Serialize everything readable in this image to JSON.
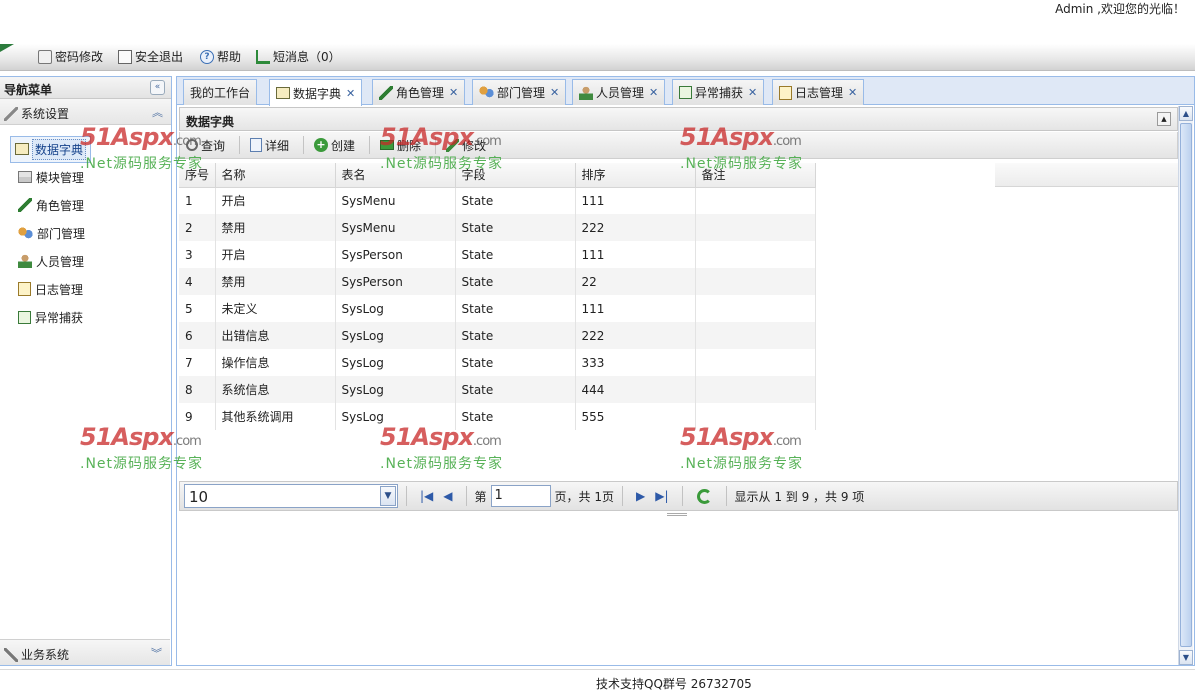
{
  "header": {
    "welcome": "Admin ,欢迎您的光临！"
  },
  "top_toolbar": [
    {
      "label": "密码修改",
      "icon": "key-icon"
    },
    {
      "label": "安全退出",
      "icon": "exit-icon"
    },
    {
      "label": "帮助",
      "icon": "help-icon"
    },
    {
      "label": "短消息（0）",
      "icon": "message-icon"
    }
  ],
  "nav": {
    "title": "导航菜单",
    "section": "系统设置",
    "items": [
      {
        "label": "数据字典",
        "icon": "dictionary-icon"
      },
      {
        "label": "模块管理",
        "icon": "module-icon"
      },
      {
        "label": "角色管理",
        "icon": "role-icon"
      },
      {
        "label": "部门管理",
        "icon": "department-icon"
      },
      {
        "label": "人员管理",
        "icon": "person-icon"
      },
      {
        "label": "日志管理",
        "icon": "log-icon"
      },
      {
        "label": "异常捕获",
        "icon": "exception-icon"
      }
    ],
    "bottom_section": "业务系统"
  },
  "tabs": [
    {
      "label": "我的工作台"
    },
    {
      "label": "数据字典"
    },
    {
      "label": "角色管理"
    },
    {
      "label": "部门管理"
    },
    {
      "label": "人员管理"
    },
    {
      "label": "异常捕获"
    },
    {
      "label": "日志管理"
    }
  ],
  "panel": {
    "title": "数据字典"
  },
  "grid_toolbar": [
    {
      "label": "查询",
      "icon": "search-icon"
    },
    {
      "label": "详细",
      "icon": "detail-icon"
    },
    {
      "label": "创建",
      "icon": "add-icon"
    },
    {
      "label": "删除",
      "icon": "delete-icon"
    },
    {
      "label": "修改",
      "icon": "edit-icon"
    }
  ],
  "table": {
    "columns": [
      "序号",
      "名称",
      "表名",
      "字段",
      "排序",
      "备注"
    ],
    "rows": [
      [
        "1",
        "开启",
        "SysMenu",
        "State",
        "111",
        ""
      ],
      [
        "2",
        "禁用",
        "SysMenu",
        "State",
        "222",
        ""
      ],
      [
        "3",
        "开启",
        "SysPerson",
        "State",
        "111",
        ""
      ],
      [
        "4",
        "禁用",
        "SysPerson",
        "State",
        "22",
        ""
      ],
      [
        "5",
        "未定义",
        "SysLog",
        "State",
        "111",
        ""
      ],
      [
        "6",
        "出错信息",
        "SysLog",
        "State",
        "222",
        ""
      ],
      [
        "7",
        "操作信息",
        "SysLog",
        "State",
        "333",
        ""
      ],
      [
        "8",
        "系统信息",
        "SysLog",
        "State",
        "444",
        ""
      ],
      [
        "9",
        "其他系统调用",
        "SysLog",
        "State",
        "555",
        ""
      ]
    ]
  },
  "pager": {
    "page_size": "10",
    "page_prefix": "第",
    "page_value": "1",
    "page_suffix": "页，共 1页",
    "summary": "显示从 1 到 9 ，共 9 项"
  },
  "footer": {
    "text": "技术支持QQ群号 26732705"
  },
  "watermark": {
    "brand": "51Aspx",
    "domain": ".com",
    "slogan": ".Net源码服务专家"
  },
  "colors": {
    "accent": "#99bbe8",
    "brand_green": "#2b7b3c"
  }
}
